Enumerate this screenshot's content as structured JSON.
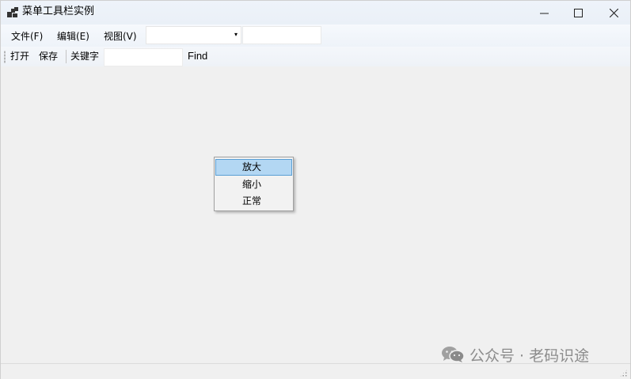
{
  "window": {
    "title": "菜单工具栏实例",
    "controls": {
      "minimize": "—",
      "maximize": "☐",
      "close": "✕"
    }
  },
  "menubar": {
    "items": [
      "文件(F)",
      "编辑(E)",
      "视图(V)"
    ],
    "combo": {
      "value": "",
      "arrow": "▾"
    },
    "textbox": {
      "value": ""
    }
  },
  "toolbar": {
    "open_label": "打开",
    "save_label": "保存",
    "keyword_label": "关键字",
    "keyword_value": "",
    "find_label": "Find"
  },
  "context_menu": {
    "items": [
      "放大",
      "缩小",
      "正常"
    ],
    "highlighted_index": 0
  },
  "watermark": {
    "text": "公众号 · 老码识途",
    "icon": "wechat-icon"
  }
}
